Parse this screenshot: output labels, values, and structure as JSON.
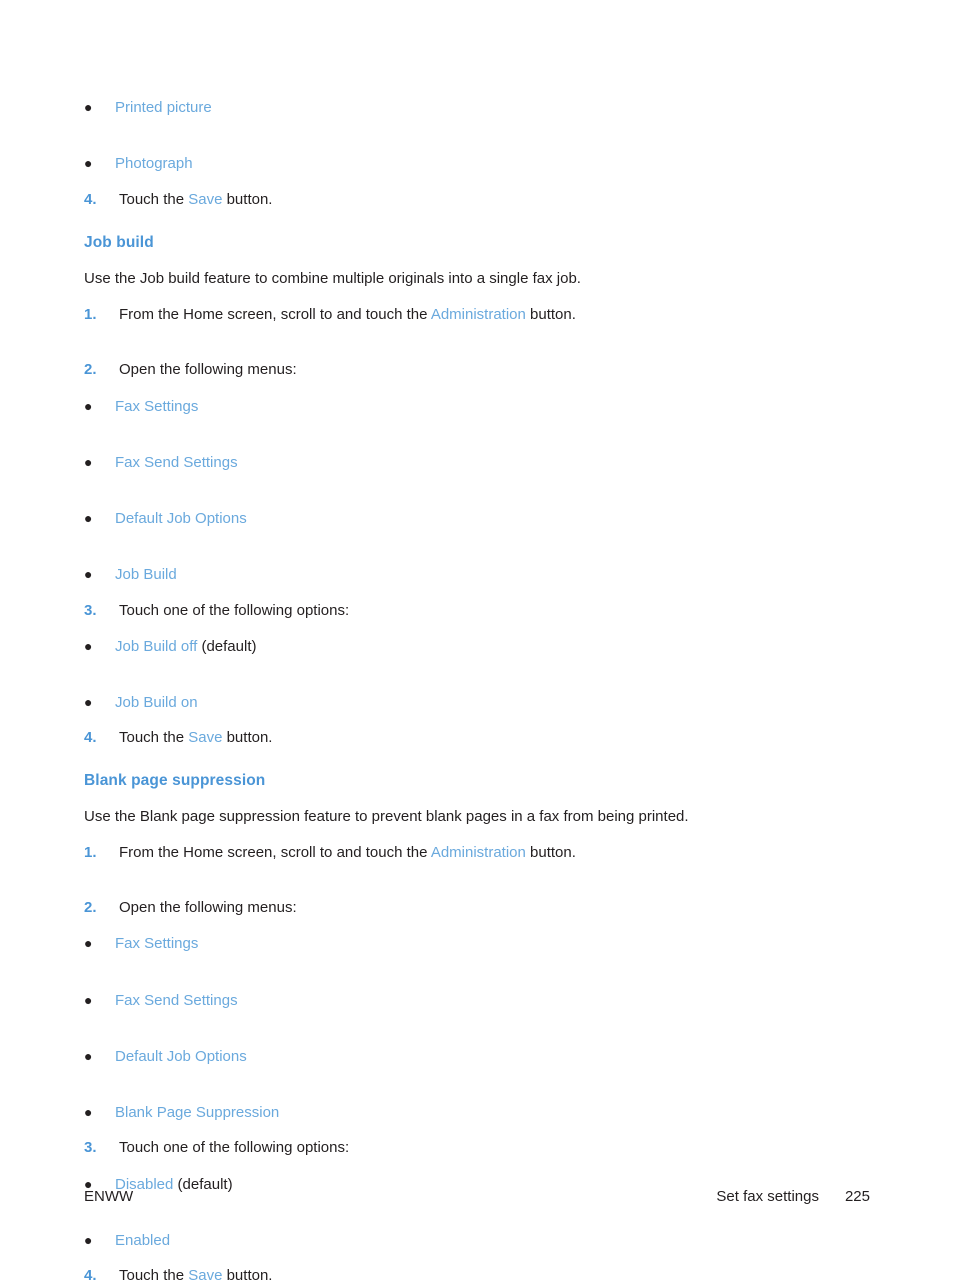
{
  "page": {
    "footer": {
      "left": "ENWW",
      "chapter": "Set fax settings",
      "page_number": "225"
    },
    "colors": {
      "heading_blue": "#4a95d6",
      "ui_term_blue": "#6aa9dd",
      "body_black": "#231f20"
    }
  },
  "top_continuation": {
    "bullets": [
      {
        "label": "Printed picture"
      },
      {
        "label": "Photograph"
      }
    ],
    "step": {
      "number": "4.",
      "prefix": "Touch the ",
      "ui_term": "Save",
      "suffix": " button."
    }
  },
  "sections": [
    {
      "heading": "Job build",
      "intro": "Use the Job build feature to combine multiple originals into a single fax job.",
      "steps": [
        {
          "number": "1.",
          "prefix": "From the Home screen, scroll to and touch the ",
          "ui_term": "Administration",
          "suffix": " button."
        },
        {
          "number": "2.",
          "prefix": "Open the following menus:",
          "ui_term": "",
          "suffix": ""
        }
      ],
      "menu_bullets": [
        {
          "label": "Fax Settings"
        },
        {
          "label": "Fax Send Settings"
        },
        {
          "label": "Default Job Options"
        },
        {
          "label": "Job Build"
        }
      ],
      "options_step": {
        "number": "3.",
        "prefix": "Touch one of the following options:"
      },
      "option_bullets": [
        {
          "label": "Job Build off",
          "note": " (default)"
        },
        {
          "label": "Job Build on",
          "note": ""
        }
      ],
      "save_step": {
        "number": "4.",
        "prefix": "Touch the ",
        "ui_term": "Save",
        "suffix": " button."
      }
    },
    {
      "heading": "Blank page suppression",
      "intro": "Use the Blank page suppression feature to prevent blank pages in a fax from being printed.",
      "steps": [
        {
          "number": "1.",
          "prefix": "From the Home screen, scroll to and touch the ",
          "ui_term": "Administration",
          "suffix": " button."
        },
        {
          "number": "2.",
          "prefix": "Open the following menus:",
          "ui_term": "",
          "suffix": ""
        }
      ],
      "menu_bullets": [
        {
          "label": "Fax Settings"
        },
        {
          "label": "Fax Send Settings"
        },
        {
          "label": "Default Job Options"
        },
        {
          "label": "Blank Page Suppression"
        }
      ],
      "options_step": {
        "number": "3.",
        "prefix": "Touch one of the following options:"
      },
      "option_bullets": [
        {
          "label": "Disabled",
          "note": " (default)"
        },
        {
          "label": "Enabled",
          "note": ""
        }
      ],
      "save_step": {
        "number": "4.",
        "prefix": "Touch the ",
        "ui_term": "Save",
        "suffix": " button."
      }
    }
  ],
  "glyphs": {
    "bullet_dot": "●"
  }
}
